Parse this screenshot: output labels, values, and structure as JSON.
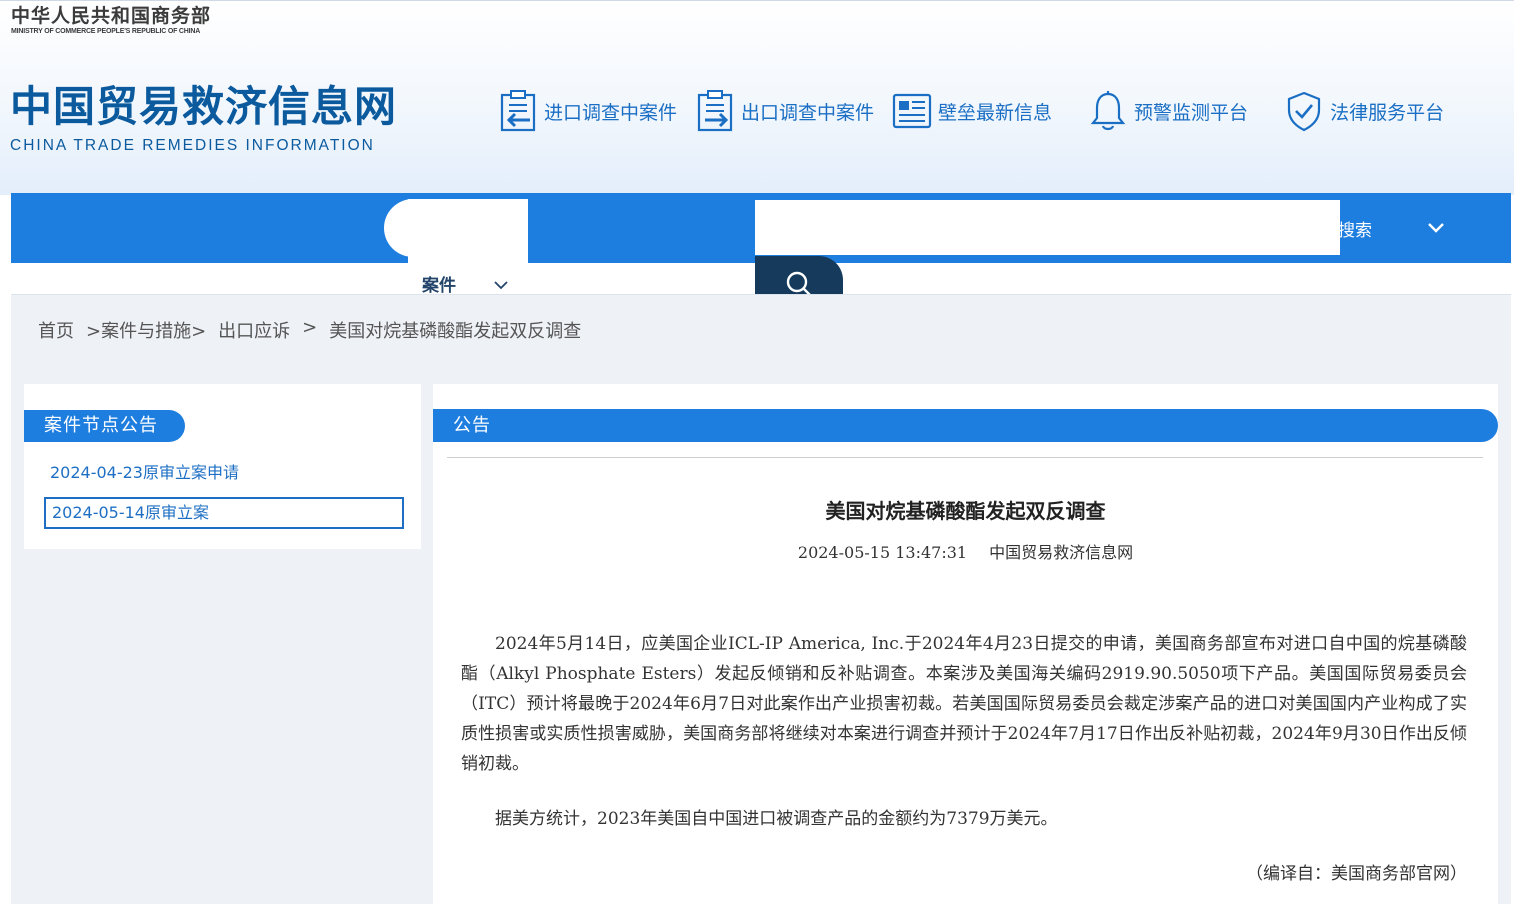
{
  "header": {
    "ministry_cn": "中华人民共和国商务部",
    "ministry_en": "MINISTRY OF COMMERCE PEOPLE'S REPUBLIC OF CHINA",
    "logo_cn": "中国贸易救济信息网",
    "logo_en": "CHINA TRADE REMEDIES INFORMATION",
    "nav": [
      {
        "label": "进口调查中案件",
        "icon": "import-case-icon"
      },
      {
        "label": "出口调查中案件",
        "icon": "export-case-icon"
      },
      {
        "label": "壁垒最新信息",
        "icon": "news-icon"
      },
      {
        "label": "预警监测平台",
        "icon": "bell-icon"
      },
      {
        "label": "法律服务平台",
        "icon": "shield-check-icon"
      }
    ]
  },
  "search": {
    "category": "案件",
    "input_value": "",
    "advanced_label": "搜索"
  },
  "breadcrumb": {
    "home": "首页",
    "level1": ">案件与措施>",
    "level2": "出口应诉",
    "sep": ">",
    "current": "美国对烷基磷酸酯发起双反调查"
  },
  "sidebar": {
    "title": "案件节点公告",
    "items": [
      {
        "label": "2024-04-23原审立案申请"
      },
      {
        "label": "2024-05-14原审立案"
      }
    ]
  },
  "main": {
    "section_title": "公告",
    "article": {
      "title": "美国对烷基磷酸酯发起双反调查",
      "datetime": "2024-05-15 13:47:31",
      "source": "中国贸易救济信息网",
      "paragraphs": [
        "2024年5月14日，应美国企业ICL-IP America, Inc.于2024年4月23日提交的申请，美国商务部宣布对进口自中国的烷基磷酸酯（Alkyl Phosphate Esters）发起反倾销和反补贴调查。本案涉及美国海关编码2919.90.5050项下产品。美国国际贸易委员会（ITC）预计将最晚于2024年6月7日对此案作出产业损害初裁。若美国国际贸易委员会裁定涉案产品的进口对美国国内产业构成了实质性损害或实质性损害威胁，美国商务部将继续对本案进行调查并预计于2024年7月17日作出反补贴初裁，2024年9月30日作出反倾销初裁。",
        "据美方统计，2023年美国自中国进口被调查产品的金额约为7379万美元。"
      ],
      "credit": "（编译自：美国商务部官网）"
    }
  },
  "colors": {
    "brand_blue": "#1e7ee0",
    "logo_blue": "#0b5a9e",
    "link_blue": "#1e6fc4",
    "dark_navy": "#153a5c",
    "background_gray": "#eef1f6"
  }
}
